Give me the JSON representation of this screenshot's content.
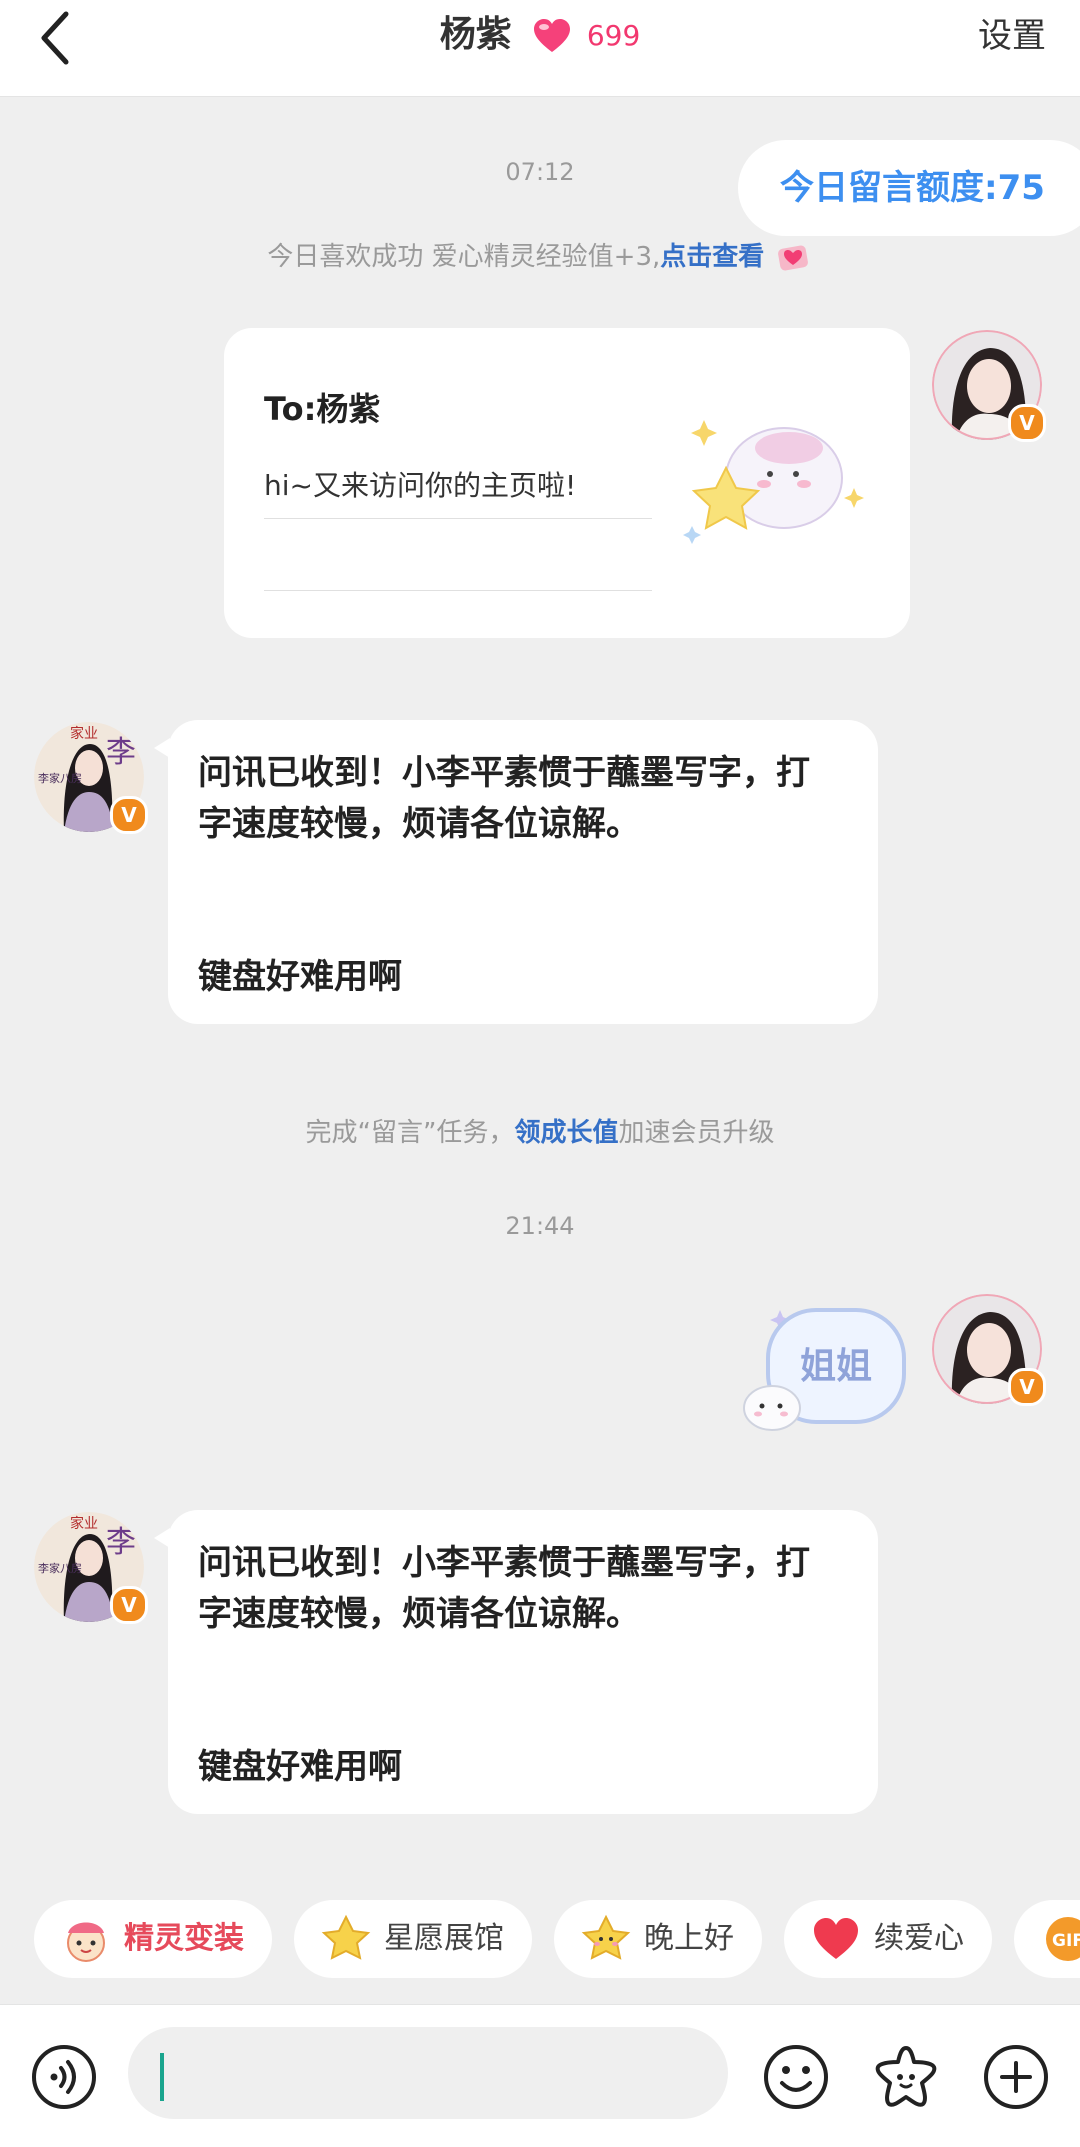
{
  "header": {
    "back_icon": "chevron-left-icon",
    "title": "杨紫",
    "heart_count": "699",
    "settings_label": "设置",
    "heart_color": "#f2386f"
  },
  "chat": {
    "time_1": "07:12",
    "quota_label": "今日留言额度:75",
    "system_like_text": "今日喜欢成功 爱心精灵经验值+3,",
    "system_like_link": "点击查看",
    "card": {
      "to_line": "To:杨紫",
      "message": "hi~又来访问你的主页啦!"
    },
    "incoming_1": {
      "line1": "问讯已收到！小李平素惯于蘸墨写字，打",
      "line2": "字速度较慢，烦请各位谅解。",
      "line3": "键盘好难用啊"
    },
    "task_text_pre": "完成“留言”任务，",
    "task_link": "领成长值",
    "task_text_post": "加速会员升级",
    "time_2": "21:44",
    "sticker_text": "姐姐",
    "incoming_2": {
      "line1": "问讯已收到！小李平素惯于蘸墨写字，打",
      "line2": "字速度较慢，烦请各位谅解。",
      "line3": "键盘好难用啊"
    },
    "avatar_badge": "V",
    "avatar_left_texts": [
      "家业",
      "李",
      "李家八房"
    ]
  },
  "chips": [
    {
      "label": "精灵变装",
      "icon": "sprite-icon",
      "color": "#e64a5b"
    },
    {
      "label": "星愿展馆",
      "icon": "star-icon",
      "color": "#444444"
    },
    {
      "label": "晚上好",
      "icon": "star-face-icon",
      "color": "#444444"
    },
    {
      "label": "续爱心",
      "icon": "heart-icon",
      "color": "#444444"
    },
    {
      "label": "GIF",
      "icon": "gif-icon",
      "color": "#f08a1c"
    }
  ],
  "input": {
    "placeholder": "",
    "accent": "#1aa58e"
  }
}
